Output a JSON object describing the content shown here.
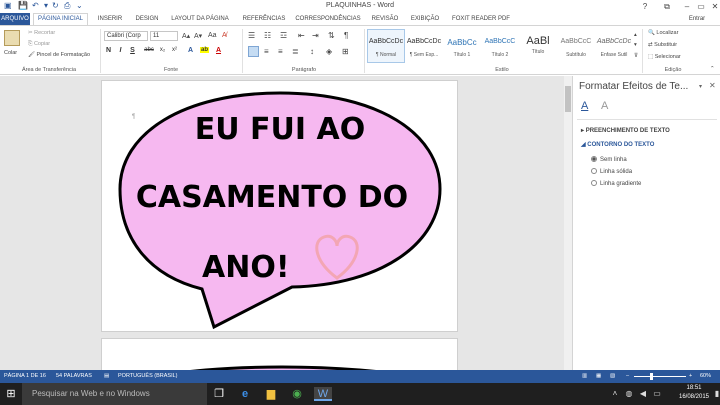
{
  "title_bar": {
    "title": "PLAQUINHAS - Word",
    "help": "?",
    "minimize": "–",
    "restore": "▭",
    "close": "✕"
  },
  "tabs": {
    "file": "ARQUIVO",
    "home": "PÁGINA INICIAL",
    "insert": "INSERIR",
    "design": "DESIGN",
    "layout": "LAYOUT DA PÁGINA",
    "references": "REFERÊNCIAS",
    "mailings": "CORRESPONDÊNCIAS",
    "review": "REVISÃO",
    "view": "EXIBIÇÃO",
    "foxit": "FOXIT READER PDF",
    "account": "Entrar"
  },
  "ribbon": {
    "clipboard": {
      "paste": "Colar",
      "cut": "Recortar",
      "copy": "Copiar",
      "format_painter": "Pincel de Formatação",
      "label": "Área de Transferência"
    },
    "font": {
      "font_name": "Calibri (Corp",
      "font_size": "11",
      "label": "Fonte",
      "bold": "N",
      "italic": "I",
      "underline": "S",
      "strike": "abc",
      "subscript": "x₂",
      "superscript": "x²"
    },
    "paragraph": {
      "label": "Parágrafo"
    },
    "styles": {
      "label": "Estilo",
      "items": [
        {
          "preview": "AaBbCcDc",
          "name": "¶ Normal"
        },
        {
          "preview": "AaBbCcDc",
          "name": "¶ Sem Esp..."
        },
        {
          "preview": "AaBbCc",
          "name": "Título 1"
        },
        {
          "preview": "AaBbCcC",
          "name": "Título 2"
        },
        {
          "preview": "AaBl",
          "name": "Título"
        },
        {
          "preview": "AaBbCcC",
          "name": "Subtítulo"
        },
        {
          "preview": "AaBbCcDc",
          "name": "Ênfase Sutil"
        }
      ]
    },
    "editing": {
      "find": "Localizar",
      "replace": "Substituir",
      "select": "Selecionar",
      "label": "Edição"
    }
  },
  "document": {
    "bubble_text": [
      "EU FUI AO",
      "CASAMENTO DO",
      "ANO!"
    ],
    "bubble_color": "#f6b8f0",
    "heart_color": "#f3a6b4"
  },
  "pane": {
    "title": "Formatar Efeitos de Te...",
    "fill_section": "PREENCHIMENTO DE TEXTO",
    "outline_section": "CONTORNO DO TEXTO",
    "options": [
      "Sem linha",
      "Linha sólida",
      "Linha gradiente"
    ],
    "selected_option": "Sem linha"
  },
  "status_bar": {
    "page": "PÁGINA 1 DE 16",
    "words": "54 PALAVRAS",
    "language": "PORTUGUÊS (BRASIL)",
    "zoom": "60%"
  },
  "taskbar": {
    "search_placeholder": "Pesquisar na Web e no Windows",
    "time": "18:51",
    "date": "16/08/2015"
  }
}
